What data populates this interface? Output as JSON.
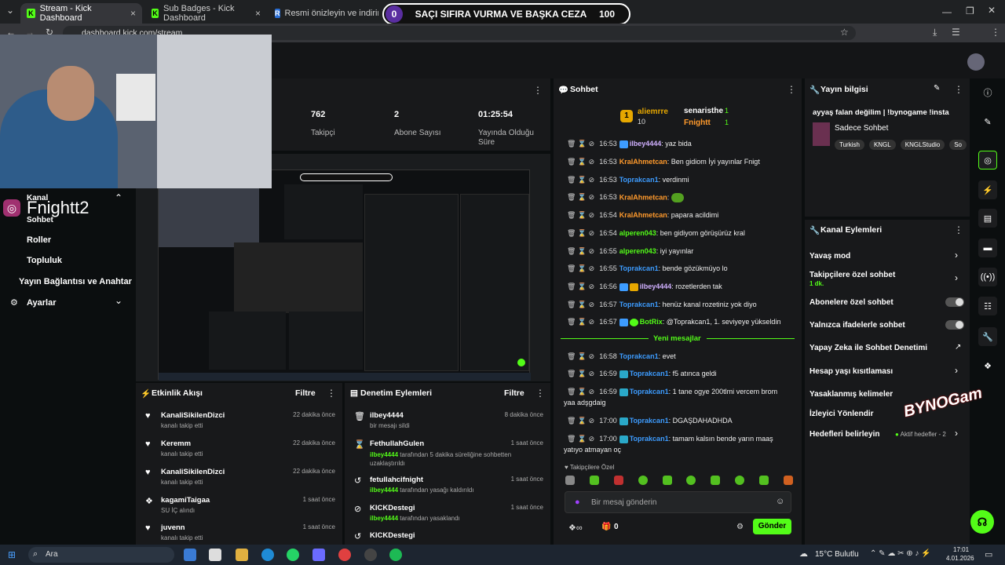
{
  "browser": {
    "tabs": [
      {
        "label": "Stream - Kick Dashboard"
      },
      {
        "label": "Sub Badges - Kick Dashboard"
      },
      {
        "label": "Resmi önizleyin ve indirin - Res"
      }
    ],
    "url": "dashboard.kick.com/stream"
  },
  "banner": {
    "left": "0",
    "text": "SAÇI SIFIRA VURMA VE BAŞKA CEZA",
    "right": "100"
  },
  "stats": [
    {
      "value": "762",
      "label": "Takipçi"
    },
    {
      "value": "2",
      "label": "Abone Sayısı"
    },
    {
      "value": "01:25:54",
      "label": "Yayında Olduğu Süre"
    }
  ],
  "overlay": {
    "instagram": "Fnightt2"
  },
  "sidebar": {
    "items": [
      "Kanal",
      "Sohbet",
      "Roller",
      "Topluluk",
      "Yayın Bağlantısı ve Anahtar",
      "Ayarlar"
    ]
  },
  "activity": {
    "title": "Etkinlik Akışı",
    "filter": "Filtre",
    "items": [
      {
        "name": "KanaliSikilenDizci",
        "desc": "kanalı takip etti",
        "time": "22 dakika önce"
      },
      {
        "name": "Keremm",
        "desc": "kanalı takip etti",
        "time": "22 dakika önce"
      },
      {
        "name": "KanaliSikilenDizci",
        "desc": "kanalı takip etti",
        "time": "22 dakika önce"
      },
      {
        "name": "kagamiTaigaa",
        "desc": "SU İÇ alındı",
        "time": "1 saat önce"
      },
      {
        "name": "juvenn",
        "desc": "kanalı takip etti",
        "time": "1 saat önce"
      }
    ]
  },
  "moderation": {
    "title": "Denetim Eylemleri",
    "filter": "Filtre",
    "items": [
      {
        "name": "ilbey4444",
        "desc": "bir mesajı sildi",
        "time": "8 dakika önce"
      },
      {
        "name": "FethullahGulen",
        "who": "ilbey4444",
        "desc": "tarafından 5 dakika süreliğine sohbetten uzaklaştırıldı",
        "time": "1 saat önce"
      },
      {
        "name": "fetullahcifnight",
        "who": "ilbey4444",
        "desc": "tarafından yasağı kaldırıldı",
        "time": "1 saat önce"
      },
      {
        "name": "KICKDestegi",
        "who": "ilbey4444",
        "desc": "tarafından yasaklandı",
        "time": "1 saat önce"
      },
      {
        "name": "KICKDestegi",
        "who": "",
        "desc": "",
        "time": ""
      }
    ]
  },
  "chat": {
    "title": "Sohbet",
    "leaderboard": [
      {
        "rank": "1",
        "name": "aliemrre",
        "count": "10"
      },
      {
        "name": "senaristhe",
        "count": "1"
      },
      {
        "name": "Fnightt",
        "count": "1"
      }
    ],
    "messages": [
      {
        "time": "16:53",
        "user": "ilbey4444",
        "text": "yaz bida",
        "color": "#d0b0ff"
      },
      {
        "time": "16:53",
        "user": "KralAhmetcan",
        "text": "Ben gidiom İyi yayınlar Fnigt",
        "color": "#ff9a2c"
      },
      {
        "time": "16:53",
        "user": "Toprakcan1",
        "text": "verdinmi",
        "color": "#3d9cff"
      },
      {
        "time": "16:53",
        "user": "KralAhmetcan",
        "text": "",
        "color": "#ff9a2c"
      },
      {
        "time": "16:54",
        "user": "KralAhmetcan",
        "text": "papara acildimi",
        "color": "#ff9a2c"
      },
      {
        "time": "16:54",
        "user": "alperen043",
        "text": "ben gidiyom görüşürüz kral",
        "color": "#53fc18"
      },
      {
        "time": "16:55",
        "user": "alperen043",
        "text": "iyi yayınlar",
        "color": "#53fc18"
      },
      {
        "time": "16:55",
        "user": "Toprakcan1",
        "text": "bende gözükmüyo lo",
        "color": "#3d9cff"
      },
      {
        "time": "16:56",
        "user": "ilbey4444",
        "text": "rozetlerden tak",
        "color": "#d0b0ff"
      },
      {
        "time": "16:57",
        "user": "Toprakcan1",
        "text": "henüz kanal rozetiniz yok diyo",
        "color": "#3d9cff"
      },
      {
        "time": "16:57",
        "user": "BotRix",
        "text": "@Toprakcan1, 1. seviyeye yükseldin",
        "color": "#53fc18"
      }
    ],
    "new_label": "Yeni mesajlar",
    "new_messages": [
      {
        "time": "16:58",
        "user": "Toprakcan1",
        "text": "evet"
      },
      {
        "time": "16:59",
        "user": "Toprakcan1",
        "text": "f5 atınca geldi"
      },
      {
        "time": "16:59",
        "user": "Toprakcan1",
        "text": "1 tane ogye 200tlmi vercem brom",
        "cont": "yaa adşgdaig"
      },
      {
        "time": "17:00",
        "user": "Toprakcan1",
        "text": "DGAŞDAHADHDA"
      },
      {
        "time": "17:00",
        "user": "Toprakcan1",
        "text": "tamam kalsın bende yarın maaş",
        "cont": "yatıyo atmayan oç"
      }
    ],
    "followers_only": "Takipçilere Özel",
    "input_placeholder": "Bir mesaj gönderin",
    "points": "0",
    "send": "Gönder"
  },
  "stream_info": {
    "title": "Yayın bilgisi",
    "stream_title": "ayyaş falan değilim | !bynogame !insta",
    "category": "Sadece Sohbet",
    "tags": [
      "Turkish",
      "KNGL",
      "KNGLStudio",
      "So"
    ]
  },
  "channel_actions": {
    "title": "Kanal Eylemleri",
    "items": [
      {
        "label": "Yavaş mod",
        "sub": ""
      },
      {
        "label": "Takipçilere özel sohbet",
        "sub": "1 dk."
      },
      {
        "label": "Abonelere özel sohbet",
        "sub": ""
      },
      {
        "label": "Yalnızca ifadelerle sohbet",
        "sub": ""
      },
      {
        "label": "Yapay Zeka ile Sohbet Denetimi",
        "sub": ""
      },
      {
        "label": "Hesap yaşı kısıtlaması",
        "sub": ""
      },
      {
        "label": "Yasaklanmış kelimeler",
        "sub": ""
      },
      {
        "label": "İzleyici Yönlendir",
        "sub": ""
      },
      {
        "label": "Hedefleri belirleyin",
        "sub": "Aktif hedefler - 2"
      }
    ]
  },
  "watermark": "BYNOGam",
  "taskbar": {
    "search": "Ara",
    "weather": "15°C Bulutlu",
    "time": "17:01",
    "date": "4.01.2026"
  },
  "colors": {
    "kick_green": "#53fc18",
    "panel": "#18191b",
    "bg": "#0b0e0f"
  }
}
